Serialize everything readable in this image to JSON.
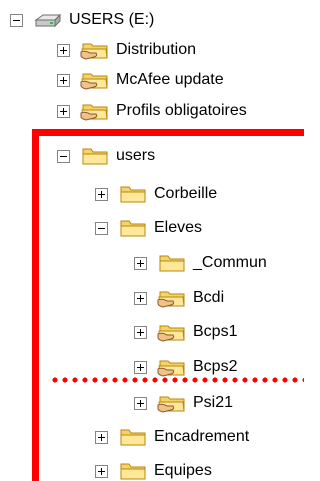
{
  "tree": {
    "drive": {
      "label": "USERS (E:)",
      "icon": "drive-icon",
      "state": "expanded"
    },
    "items": [
      {
        "label": "Distribution",
        "icon": "shared-folder-icon",
        "state": "collapsed"
      },
      {
        "label": "McAfee update",
        "icon": "shared-folder-icon",
        "state": "collapsed"
      },
      {
        "label": "Profils obligatoires",
        "icon": "shared-folder-icon",
        "state": "collapsed"
      },
      {
        "label": "users",
        "icon": "folder-icon",
        "state": "expanded"
      },
      {
        "label": "Corbeille",
        "icon": "folder-icon",
        "state": "collapsed"
      },
      {
        "label": "Eleves",
        "icon": "folder-icon",
        "state": "expanded"
      },
      {
        "label": "_Commun",
        "icon": "folder-icon",
        "state": "collapsed"
      },
      {
        "label": "Bcdi",
        "icon": "shared-folder-icon",
        "state": "collapsed"
      },
      {
        "label": "Bcps1",
        "icon": "shared-folder-icon",
        "state": "collapsed"
      },
      {
        "label": "Bcps2",
        "icon": "shared-folder-icon",
        "state": "collapsed"
      },
      {
        "label": "Psi21",
        "icon": "shared-folder-icon",
        "state": "collapsed"
      },
      {
        "label": "Encadrement",
        "icon": "folder-icon",
        "state": "collapsed"
      },
      {
        "label": "Equipes",
        "icon": "folder-icon",
        "state": "collapsed"
      }
    ]
  },
  "colors": {
    "highlight": "#ff0000",
    "folder": "#f5d36b",
    "folder_outline": "#b8860b"
  }
}
